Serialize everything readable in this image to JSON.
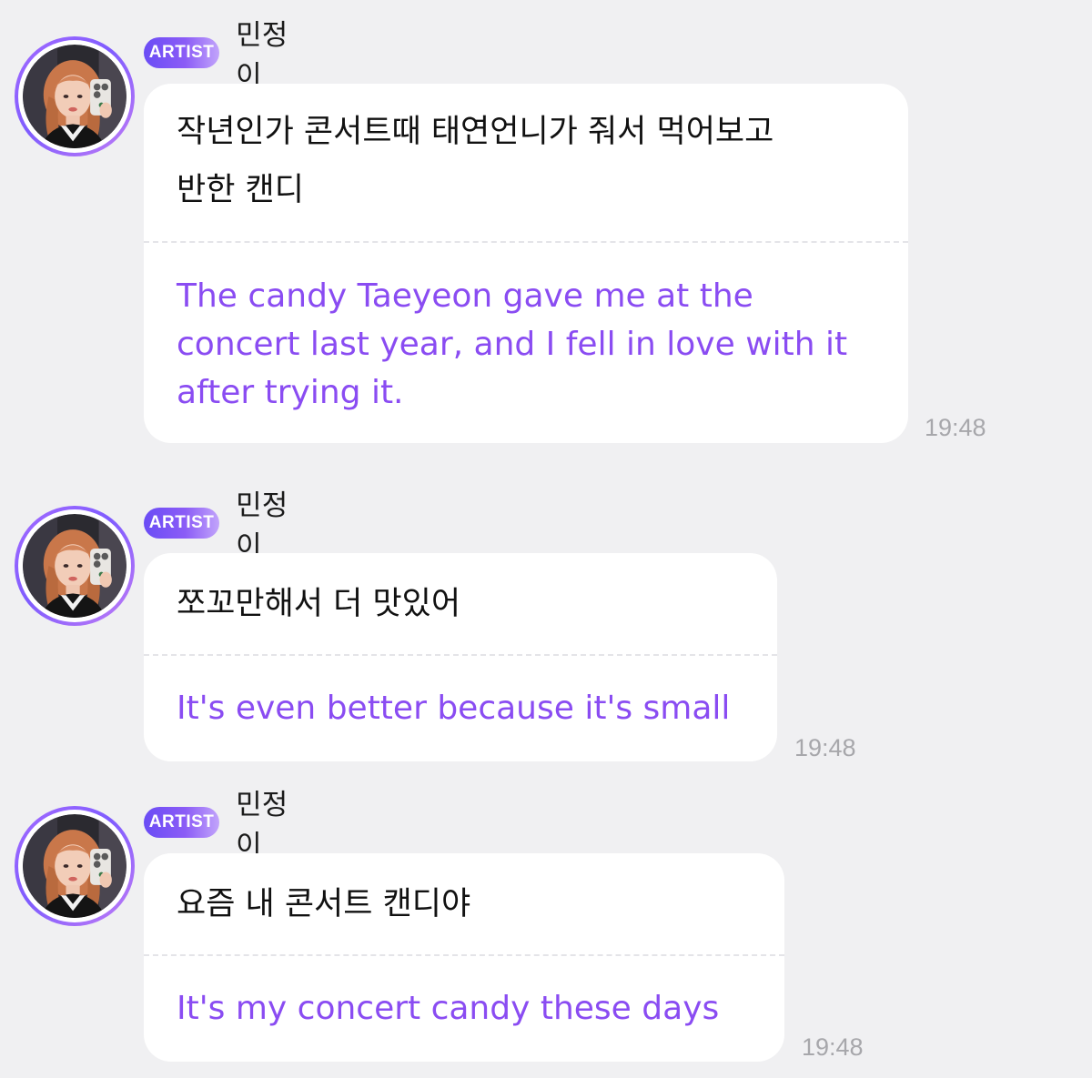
{
  "messages": [
    {
      "badge": "ARTIST",
      "sender": "민정이",
      "original": "작년인가 콘서트때 태연언니가 줘서 먹어보고\n반한 캔디",
      "translation": "The candy Taeyeon gave me at the concert last year, and I fell in love with it after trying it.",
      "time": "19:48"
    },
    {
      "badge": "ARTIST",
      "sender": "민정이",
      "original": "쪼꼬만해서 더 맛있어",
      "translation": "It's even better because it's small",
      "time": "19:48"
    },
    {
      "badge": "ARTIST",
      "sender": "민정이",
      "original": "요즘 내 콘서트 캔디야",
      "translation": "It's my concert candy these days",
      "time": "19:48"
    }
  ],
  "colors": {
    "background": "#f0f0f2",
    "bubble": "#ffffff",
    "translation_text": "#8a4cf2",
    "badge_gradient_start": "#6a4cf5",
    "badge_gradient_end": "#c2a4fb",
    "timestamp": "#a7a7ab"
  }
}
